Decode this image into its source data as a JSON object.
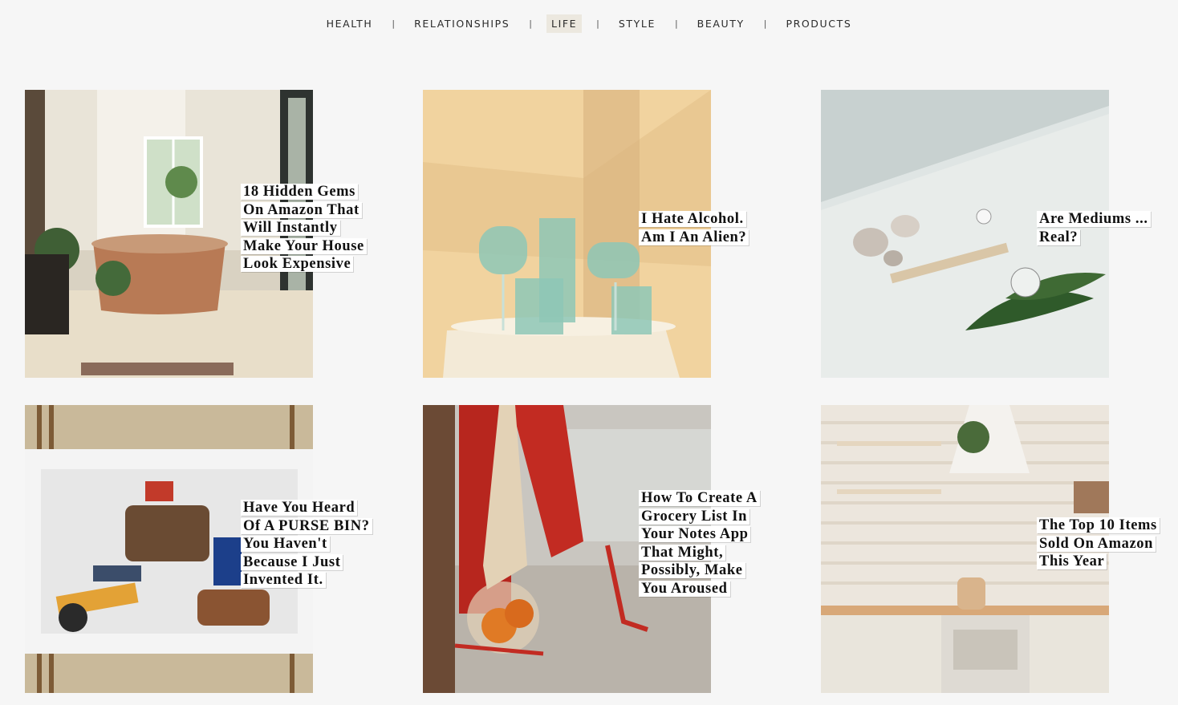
{
  "nav": {
    "items": [
      {
        "label": "HEALTH",
        "active": false
      },
      {
        "label": "RELATIONSHIPS",
        "active": false
      },
      {
        "label": "LIFE",
        "active": true
      },
      {
        "label": "STYLE",
        "active": false
      },
      {
        "label": "BEAUTY",
        "active": false
      },
      {
        "label": "PRODUCTS",
        "active": false
      }
    ],
    "separator": "|"
  },
  "articles": [
    {
      "title_lines": [
        "18 Hidden Gems",
        "On Amazon That",
        "Will Instantly",
        "Make Your House",
        "Look Expensive"
      ],
      "image": "copper bathtub in sunlit bathroom"
    },
    {
      "title_lines": [
        "I Hate Alcohol.",
        "Am I An Alien?"
      ],
      "image": "glasses filled with blue water on table"
    },
    {
      "title_lines": [
        "Are Mediums ...",
        "Real?"
      ],
      "image": "crystals, incense and leaf on white"
    },
    {
      "title_lines": [
        "Have You Heard",
        "Of A PURSE BIN?",
        "You Haven't",
        "Because I Just",
        "Invented It."
      ],
      "image": "white basket with purse items"
    },
    {
      "title_lines": [
        "How To Create A",
        "Grocery List In",
        "Your Notes App",
        "That Might,",
        "Possibly, Make",
        "You Aroused"
      ],
      "image": "mesh grocery bag with oranges"
    },
    {
      "title_lines": [
        "The Top 10 Items",
        "Sold On Amazon",
        "This Year"
      ],
      "image": "white brick kitchen with shelves"
    }
  ]
}
